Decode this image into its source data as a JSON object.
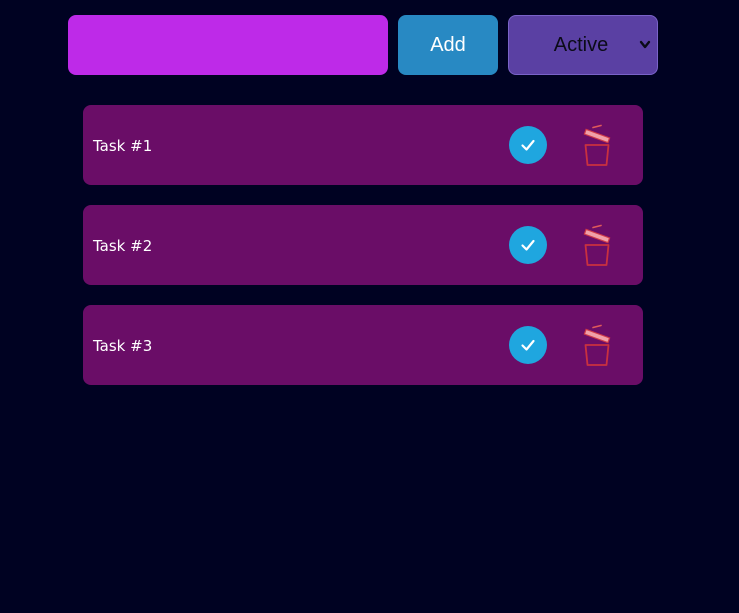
{
  "toolbar": {
    "input_value": "",
    "add_label": "Add",
    "filter_selected": "Active"
  },
  "tasks": [
    {
      "label": "Task #1"
    },
    {
      "label": "Task #2"
    },
    {
      "label": "Task #3"
    }
  ],
  "icons": {
    "complete": "check-icon",
    "delete": "trash-icon"
  },
  "colors": {
    "background": "#000222",
    "input_bg": "#be2ae8",
    "add_button": "#2889c3",
    "filter_bg": "#5a40a3",
    "task_bg": "#6a0d67",
    "check_bg": "#1fa6df",
    "trash": "#c9303f"
  }
}
